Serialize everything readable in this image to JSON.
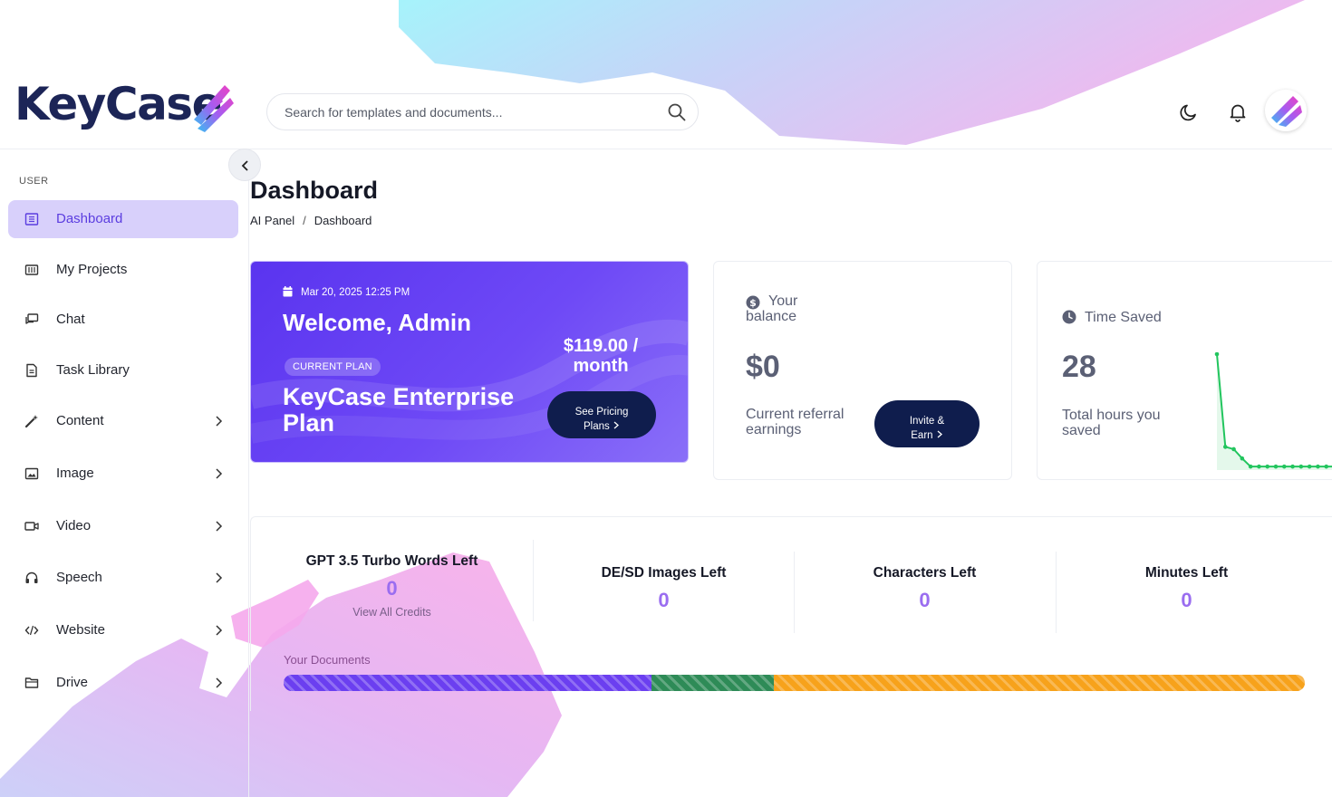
{
  "brand": {
    "name": "KeyCase"
  },
  "header": {
    "search_placeholder": "Search for templates and documents...",
    "icons": [
      "search-icon",
      "moon-icon",
      "bell-icon"
    ]
  },
  "sidebar": {
    "section": "USER",
    "items": [
      {
        "label": "Dashboard",
        "icon": "dashboard-icon",
        "active": true,
        "has_submenu": false
      },
      {
        "label": "My Projects",
        "icon": "projects-icon",
        "active": false,
        "has_submenu": false
      },
      {
        "label": "Chat",
        "icon": "chat-icon",
        "active": false,
        "has_submenu": false
      },
      {
        "label": "Task Library",
        "icon": "document-icon",
        "active": false,
        "has_submenu": false
      },
      {
        "label": "Content",
        "icon": "magic-wand-icon",
        "active": false,
        "has_submenu": true
      },
      {
        "label": "Image",
        "icon": "image-icon",
        "active": false,
        "has_submenu": true
      },
      {
        "label": "Video",
        "icon": "video-icon",
        "active": false,
        "has_submenu": true
      },
      {
        "label": "Speech",
        "icon": "headphones-icon",
        "active": false,
        "has_submenu": true
      },
      {
        "label": "Website",
        "icon": "code-icon",
        "active": false,
        "has_submenu": true
      },
      {
        "label": "Drive",
        "icon": "folder-icon",
        "active": false,
        "has_submenu": true
      }
    ]
  },
  "page": {
    "title": "Dashboard",
    "breadcrumb": [
      "AI Panel",
      "Dashboard"
    ]
  },
  "welcome": {
    "date": "Mar 20, 2025 12:25 PM",
    "greeting": "Welcome, Admin",
    "badge": "CURRENT PLAN",
    "plan": "KeyCase Enterprise Plan",
    "price_line1": "$119.00 /",
    "price_line2": "month",
    "button_line1": "See Pricing",
    "button_line2": "Plans"
  },
  "balance": {
    "title_line1": "Your",
    "title_line2": "balance",
    "amount": "$0",
    "subtitle": "Current referral earnings",
    "button_line1": "Invite &",
    "button_line2": "Earn"
  },
  "time_saved": {
    "title": "Time Saved",
    "value": "28",
    "subtitle": "Total hours you saved",
    "sparkline": [
      100,
      20,
      18,
      10,
      3,
      3,
      3,
      3,
      3,
      3,
      3,
      3,
      3,
      3,
      3
    ]
  },
  "credits": [
    {
      "label": "GPT 3.5 Turbo Words Left",
      "value": "0",
      "link": "View All Credits"
    },
    {
      "label": "DE/SD Images Left",
      "value": "0"
    },
    {
      "label": "Characters Left",
      "value": "0"
    },
    {
      "label": "Minutes Left",
      "value": "0"
    }
  ],
  "documents": {
    "label": "Your Documents",
    "segments": [
      {
        "fraction": 0.36,
        "color": "#6b3ff0"
      },
      {
        "fraction": 0.12,
        "color": "#2e8b57"
      },
      {
        "fraction": 0.52,
        "color": "#f7a21b"
      }
    ]
  },
  "colors": {
    "accent": "#5b3de0",
    "navy": "#0f1d4d",
    "credit_value": "#9a6df0",
    "sparkline": "#22c55e"
  }
}
